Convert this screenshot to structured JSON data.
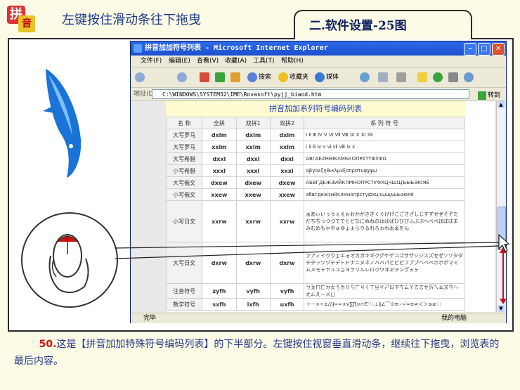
{
  "header": {
    "title": "左键按住滑动条往下拖曳",
    "figure_label": "二.软件设置-25图",
    "logo": {
      "char1": "拼",
      "char2": "音"
    }
  },
  "window": {
    "title": "拼音加加符号列表 - Microsoft Internet Explorer",
    "menu": [
      "文件(F)",
      "编辑(E)",
      "查看(V)",
      "收藏(A)",
      "工具(T)",
      "帮助(H)"
    ],
    "toolbar": {
      "search": "搜索",
      "favorites": "收藏夹",
      "media": "媒体"
    },
    "address_label": "地址(D)",
    "address": "C:\\WINDOWS\\SYSTEM32\\IME\\Rovasoft\\pyjj_biaod.htm",
    "go_label": "转到",
    "status_left": "完毕",
    "status_right": "我的电脑"
  },
  "table": {
    "caption": "拼音加加系列符号编码列表",
    "headers": [
      "名 称",
      "全拼",
      "双拼1",
      "双拼2",
      "系 列 符 号"
    ],
    "rows": [
      {
        "name": "大写罗马",
        "qp": "dxlm",
        "sp1": "dxlm",
        "sp2": "dxlm",
        "sym": "Ⅰ Ⅱ Ⅲ Ⅳ Ⅴ Ⅵ Ⅶ Ⅷ Ⅸ Ⅹ Ⅺ Ⅻ"
      },
      {
        "name": "大写罗马",
        "qp": "xxlm",
        "sp1": "xxlm",
        "sp2": "xxlm",
        "sym": "ⅰ ⅱ ⅲ ⅳ ⅴ ⅵ ⅶ ⅷ ⅸ ⅹ"
      },
      {
        "name": "大写希腊",
        "qp": "dxxl",
        "sp1": "dxxl",
        "sp2": "dxxl",
        "sym": "ΑΒΓΔΕΖΗΘΙΚΛΜΝΞΟΠΡΣΤΥΦΧΨΩ"
      },
      {
        "name": "小写希腊",
        "qp": "xxxl",
        "sp1": "xxxl",
        "sp2": "xxxl",
        "sym": "αβγδεζηθικλμνξοπρστυφχψω"
      },
      {
        "name": "大写俄文",
        "qp": "dxew",
        "sp1": "dxew",
        "sp2": "dxew",
        "sym": "АБВГДЕЖЗИЙКЛМНОПРСТУФХЦЧШЩЪЫЬЭЮЯЁ"
      },
      {
        "name": "小写俄文",
        "qp": "xxew",
        "sp1": "xxew",
        "sp2": "xxew",
        "sym": "абвгдежзийклмнопрстуфхцчшщъыьэюяё"
      },
      {
        "name": "小写日文",
        "qp": "xxrw",
        "sp1": "xxrw",
        "sp2": "xxrw",
        "sym": "ぁあぃいぅうぇえぉおかがきぎくぐけげこごさざしじすずせぜそぞただちぢっつづてでとどなにぬねのはばぱひびぴふぶぷへべぺほぼぽまみむめもゃやゅゆょよらりるれろゎわゐゑをん"
      },
      {
        "name": "大写日文",
        "qp": "dxrw",
        "sp1": "dxrw",
        "sp2": "dxrw",
        "sym": "ァアィイゥウェエォオカガキギクグケゲコゴサザシジスズセゼソゾタダチヂッツヅテデトドナニヌネノハバパヒビピフブプヘベペホボポマミムメモャヤュユョヨラリルレロヮワヰヱヲンヴヵヶ"
      },
      {
        "name": "注音符号",
        "qp": "zyfh",
        "sp1": "vyfh",
        "sp2": "vyfh",
        "sym": "ㄅㄆㄇㄈㄉㄊㄋㄌㄍㄎㄏㄐㄑㄒㄓㄔㄕㄖㄗㄘㄙㄚㄛㄜㄝㄞㄟㄠㄡㄢㄣㄤㄥㄦㄧㄨㄩ"
      },
      {
        "name": "数学符号",
        "qp": "sxfh",
        "sp1": "ixfh",
        "sp2": "uxfh",
        "sym": "＋－×÷±∕∫∮∝∞∧∨∑∏∪∩∈∵∴⊥∥∠⌒⊙≌∽√≈≡≠＜＞≤≥∶∷"
      }
    ]
  },
  "caption": {
    "number": "50.",
    "text": "这是【拼音加加特殊符号编码列表】的下半部分。左键按住视窗垂直滑动条，继续往下拖曳，浏览表的最后内容。"
  }
}
